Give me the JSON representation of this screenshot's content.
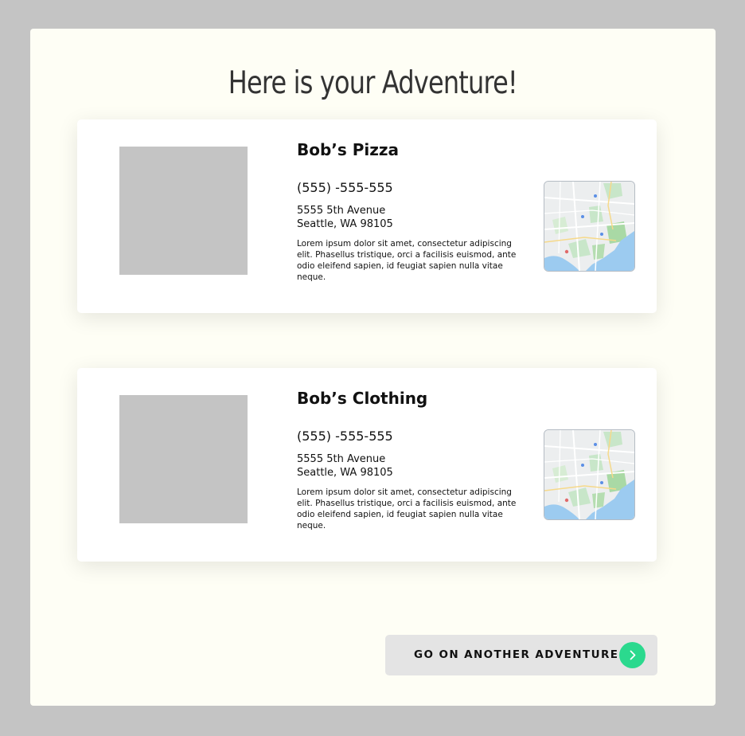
{
  "page": {
    "title": "Here is your Adventure!"
  },
  "results": [
    {
      "name": "Bob’s Pizza",
      "phone": "(555) -555-555",
      "address_line1": "5555 5th Avenue",
      "address_line2": "Seattle, WA 98105",
      "description": "Lorem ipsum dolor sit amet, consectetur adipiscing elit. Phasellus tristique, orci a facilisis euismod, ante odio eleifend sapien, id feugiat sapien nulla vitae neque."
    },
    {
      "name": "Bob’s Clothing",
      "phone": "(555) -555-555",
      "address_line1": "5555 5th Avenue",
      "address_line2": "Seattle, WA 98105",
      "description": "Lorem ipsum dolor sit amet, consectetur adipiscing elit. Phasellus tristique, orci a facilisis euismod, ante odio eleifend sapien, id feugiat sapien nulla vitae neque."
    }
  ],
  "cta": {
    "label": "GO ON ANOTHER ADVENTURE !",
    "icon": "chevron-right-icon"
  },
  "colors": {
    "page_background": "#c4c4c4",
    "panel_background": "#fefef5",
    "card_background": "#ffffff",
    "image_placeholder": "#c4c4c4",
    "button_background": "#e4e4e4",
    "accent": "#2bd98e"
  }
}
